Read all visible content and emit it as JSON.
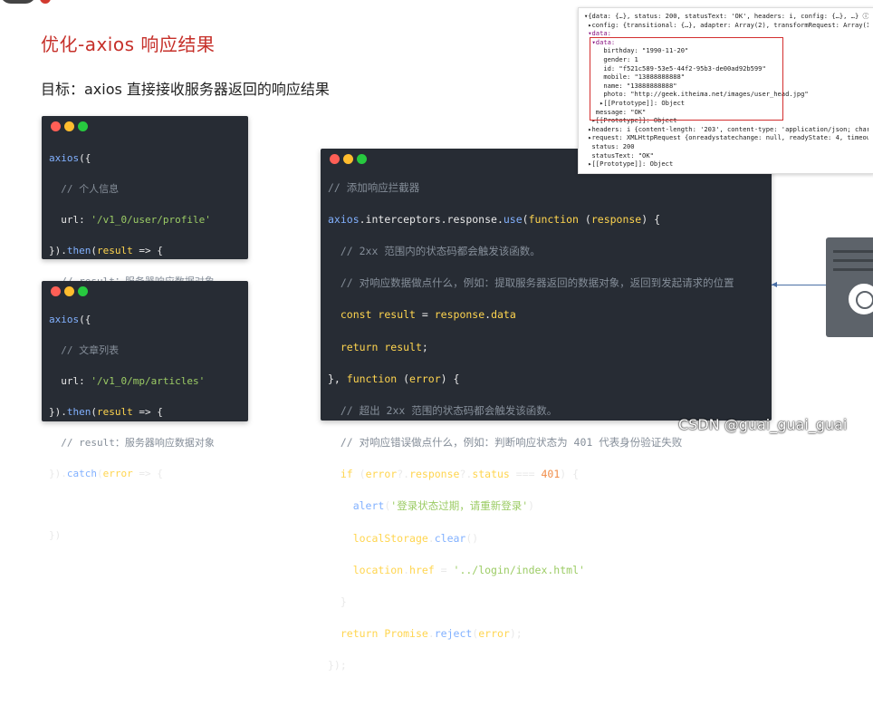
{
  "slide": {
    "title": "优化-axios 响应结果",
    "subtitle": "目标：axios 直接接收服务器返回的响应结果"
  },
  "code_profile": {
    "lines": [
      "axios({",
      "  // 个人信息",
      "  url: '/v1_0/user/profile'",
      "}).then(result => {",
      "  // result：服务器响应数据对象",
      "}).catch(error => {",
      "",
      "})"
    ]
  },
  "code_articles": {
    "lines": [
      "axios({",
      "  // 文章列表",
      "  url: '/v1_0/mp/articles'",
      "}).then(result => {",
      "  // result：服务器响应数据对象",
      "}).catch(error => {",
      "",
      "})"
    ]
  },
  "code_interceptor": {
    "lines": [
      "// 添加响应拦截器",
      "axios.interceptors.response.use(function (response) {",
      "  // 2xx 范围内的状态码都会触发该函数。",
      "  // 对响应数据做点什么，例如：提取服务器返回的数据对象，返回到发起请求的位置",
      "  const result = response.data",
      "  return result;",
      "}, function (error) {",
      "  // 超出 2xx 范围的状态码都会触发该函数。",
      "  // 对响应错误做点什么，例如：判断响应状态为 401 代表身份验证失败",
      "  if (error?.response?.status === 401) {",
      "    alert('登录状态过期，请重新登录')",
      "    localStorage.clear()",
      "    location.href = '../login/index.html'",
      "  }",
      "  return Promise.reject(error);",
      "});"
    ]
  },
  "devtools": {
    "lines": [
      "▾{data: {…}, status: 200, statusText: 'OK', headers: i, config: {…}, …} ⓘ",
      " ▸config: {transitional: {…}, adapter: Array(2), transformRequest: Array(1), tr",
      " ▾data:",
      "  ▾data:",
      "     birthday: \"1990-11-20\"",
      "     gender: 1",
      "     id: \"f521c589-53e5-44f2-95b3-de00ad92b599\"",
      "     mobile: \"13888888888\"",
      "     name: \"13888888888\"",
      "     photo: \"http://geek.itheima.net/images/user_head.jpg\"",
      "    ▸[[Prototype]]: Object",
      "   message: \"OK\"",
      "  ▸[[Prototype]]: Object",
      " ▸headers: i {content-length: '203', content-type: 'application/json; charset",
      " ▸request: XMLHttpRequest {onreadystatechange: null, readyState: 4, timeout: 0",
      "  status: 200",
      "  statusText: \"OK\"",
      " ▸[[Prototype]]: Object"
    ]
  },
  "watermark": "CSDN @guai_guai_guai",
  "colors": {
    "title_red": "#c6302a",
    "code_bg": "#272c34",
    "highlight_border": "#d32f2f"
  }
}
